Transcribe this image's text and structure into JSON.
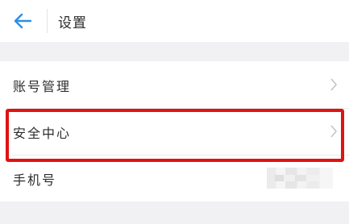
{
  "header": {
    "title": "设置",
    "back_icon": "arrow-left-icon",
    "accent_color": "#2b8fe8"
  },
  "settings": {
    "items": [
      {
        "label": "账号管理",
        "icon": "chevron-right-icon"
      },
      {
        "label": "安全中心",
        "icon": "chevron-right-icon"
      },
      {
        "label": "手机号",
        "value_masked": true
      }
    ]
  },
  "highlight": {
    "target": "安全中心",
    "color": "#e01212"
  }
}
